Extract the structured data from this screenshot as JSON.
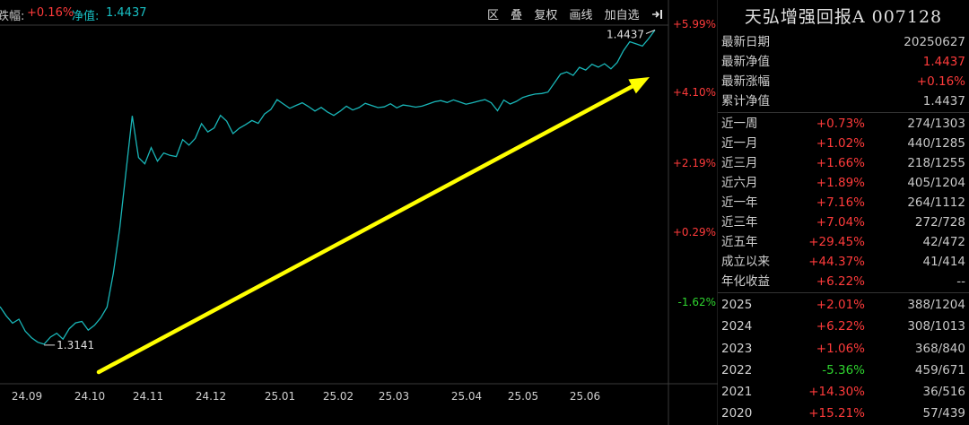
{
  "header": {
    "change_label": "跌幅:",
    "change_value": "+0.16%",
    "nav_label": "净值:",
    "nav_value": "1.4437",
    "buttons": [
      "区",
      "叠",
      "复权",
      "画线",
      "加自选"
    ],
    "export_icon": "arrow-into-bar-icon"
  },
  "colors": {
    "background": "#000000",
    "line": "#19b6b8",
    "arrow": "#ffff00",
    "up": "#ff3b3b",
    "down": "#2fd52f"
  },
  "chart_data": {
    "type": "line",
    "x_ticks": [
      "24.09",
      "24.10",
      "24.11",
      "24.12",
      "25.01",
      "25.02",
      "25.03",
      "25.04",
      "25.05",
      "25.06"
    ],
    "right_axis_ticks": [
      "+5.99%",
      "+4.10%",
      "+2.19%",
      "+0.29%",
      "-1.62%"
    ],
    "ylim": [
      1.3,
      1.445
    ],
    "annotations": {
      "min_label": "1.3141",
      "max_label": "1.4437"
    },
    "series": [
      {
        "values": [
          1.3296,
          1.3258,
          1.3228,
          1.3244,
          1.3195,
          1.3168,
          1.3149,
          1.3141,
          1.317,
          1.3186,
          1.3162,
          1.3205,
          1.3229,
          1.3235,
          1.3199,
          1.3219,
          1.325,
          1.3294,
          1.3433,
          1.3618,
          1.3852,
          1.4083,
          1.3911,
          1.3885,
          1.3952,
          1.3896,
          1.393,
          1.392,
          1.3915,
          1.3985,
          1.3962,
          1.399,
          1.4051,
          1.4017,
          1.4033,
          1.4085,
          1.4061,
          1.401,
          1.4032,
          1.4047,
          1.4064,
          1.4052,
          1.4091,
          1.4109,
          1.415,
          1.4132,
          1.4114,
          1.4126,
          1.4137,
          1.4121,
          1.4103,
          1.4118,
          1.4099,
          1.4085,
          1.4102,
          1.4123,
          1.4107,
          1.4117,
          1.4135,
          1.4126,
          1.4117,
          1.412,
          1.4133,
          1.4116,
          1.4128,
          1.4124,
          1.4119,
          1.4123,
          1.4132,
          1.4141,
          1.4146,
          1.4138,
          1.4149,
          1.414,
          1.4131,
          1.4137,
          1.4144,
          1.415,
          1.4137,
          1.4104,
          1.4148,
          1.4132,
          1.4143,
          1.4159,
          1.4167,
          1.4173,
          1.4175,
          1.4181,
          1.4218,
          1.4255,
          1.4264,
          1.425,
          1.4283,
          1.4272,
          1.4296,
          1.4284,
          1.4298,
          1.4277,
          1.4303,
          1.4352,
          1.4389,
          1.438,
          1.4371,
          1.4402,
          1.4437
        ]
      }
    ]
  },
  "panel": {
    "fund_name": "天弘增强回报A 007128",
    "info": [
      {
        "label": "最新日期",
        "value": "20250627",
        "color": "grey"
      },
      {
        "label": "最新净值",
        "value": "1.4437",
        "color": "red"
      },
      {
        "label": "最新涨幅",
        "value": "+0.16%",
        "color": "red"
      },
      {
        "label": "累计净值",
        "value": "1.4437",
        "color": "grey"
      }
    ],
    "periods": [
      {
        "label": "近一周",
        "pct": "+0.73%",
        "rank": "274/1303",
        "color": "red"
      },
      {
        "label": "近一月",
        "pct": "+1.02%",
        "rank": "440/1285",
        "color": "red"
      },
      {
        "label": "近三月",
        "pct": "+1.66%",
        "rank": "218/1255",
        "color": "red"
      },
      {
        "label": "近六月",
        "pct": "+1.89%",
        "rank": "405/1204",
        "color": "red"
      },
      {
        "label": "近一年",
        "pct": "+7.16%",
        "rank": "264/1112",
        "color": "red"
      },
      {
        "label": "近三年",
        "pct": "+7.04%",
        "rank": "272/728",
        "color": "red"
      },
      {
        "label": "近五年",
        "pct": "+29.45%",
        "rank": "42/472",
        "color": "red"
      },
      {
        "label": "成立以来",
        "pct": "+44.37%",
        "rank": "41/414",
        "color": "red"
      },
      {
        "label": "年化收益",
        "pct": "+6.22%",
        "rank": "--",
        "color": "red"
      }
    ],
    "years": [
      {
        "label": "2025",
        "pct": "+2.01%",
        "rank": "388/1204",
        "color": "red"
      },
      {
        "label": "2024",
        "pct": "+6.22%",
        "rank": "308/1013",
        "color": "red"
      },
      {
        "label": "2023",
        "pct": "+1.06%",
        "rank": "368/840",
        "color": "red"
      },
      {
        "label": "2022",
        "pct": "-5.36%",
        "rank": "459/671",
        "color": "green"
      },
      {
        "label": "2021",
        "pct": "+14.30%",
        "rank": "36/516",
        "color": "red"
      },
      {
        "label": "2020",
        "pct": "+15.21%",
        "rank": "57/439",
        "color": "red"
      }
    ]
  }
}
